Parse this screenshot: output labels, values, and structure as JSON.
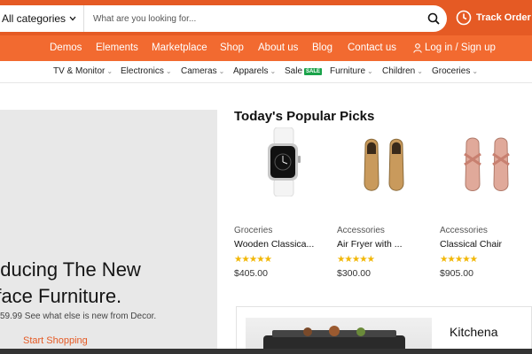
{
  "header": {
    "category_select": "All categories",
    "search_placeholder": "What are you looking for...",
    "track_order": "Track Order"
  },
  "nav": {
    "items": [
      "Demos",
      "Elements",
      "Marketplace",
      "Shop",
      "About us",
      "Blog",
      "Contact us"
    ],
    "login": "Log in / Sign up"
  },
  "categories": {
    "items": [
      "TV & Monitor",
      "Electronics",
      "Cameras",
      "Apparels",
      "Sale",
      "Furniture",
      "Children",
      "Groceries"
    ],
    "sale_badge": "SALE"
  },
  "hero": {
    "title_line1": "oducing The New",
    "title_line2": "rface Furniture.",
    "subtitle": "59.99 See what else is new from Decor.",
    "cta": "Start Shopping"
  },
  "picks": {
    "title": "Today's Popular Picks",
    "products": [
      {
        "category": "Groceries",
        "name": "Wooden Classica...",
        "price": "$405.00",
        "rating": 5,
        "icon": "watch-icon"
      },
      {
        "category": "Accessories",
        "name": "Air Fryer with ...",
        "price": "$300.00",
        "rating": 5,
        "icon": "loafers-icon"
      },
      {
        "category": "Accessories",
        "name": "Classical Chair",
        "price": "$905.00",
        "rating": 5,
        "icon": "sandals-icon"
      }
    ]
  },
  "banner": {
    "label": "Kitchena"
  },
  "colors": {
    "brand": "#e55a24",
    "nav": "#f26a30",
    "star": "#f2b705",
    "sale": "#1aa34a"
  }
}
